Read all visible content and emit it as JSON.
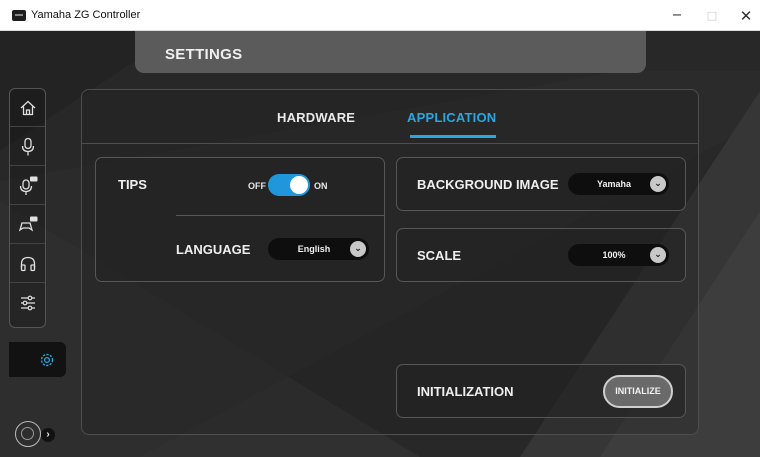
{
  "window": {
    "title": "Yamaha ZG Controller",
    "minimize_glyph": "−",
    "maximize_glyph": "□",
    "close_glyph": "✕"
  },
  "header": {
    "title": "SETTINGS"
  },
  "sidebar": {
    "items": [
      {
        "icon": "home-icon"
      },
      {
        "icon": "microphone-icon"
      },
      {
        "icon": "microphone-fx-icon"
      },
      {
        "icon": "gamepad-fx-icon"
      },
      {
        "icon": "headphones-icon"
      },
      {
        "icon": "sliders-icon"
      }
    ],
    "active_item": {
      "icon": "gear-icon"
    },
    "expand_glyph": "›"
  },
  "tabs": [
    {
      "label": "HARDWARE",
      "active": false
    },
    {
      "label": "APPLICATION",
      "active": true
    }
  ],
  "settings": {
    "tips": {
      "label": "TIPS",
      "off_label": "OFF",
      "on_label": "ON",
      "enabled": true
    },
    "language": {
      "label": "LANGUAGE",
      "value": "English"
    },
    "background_image": {
      "label": "BACKGROUND IMAGE",
      "value": "Yamaha"
    },
    "scale": {
      "label": "SCALE",
      "value": "100%"
    },
    "initialization": {
      "label": "INITIALIZATION",
      "button_label": "INITIALIZE"
    }
  },
  "colors": {
    "accent": "#2aa7e0",
    "toggle_on": "#1f97da",
    "background": "#272727",
    "header": "#5b5b5b"
  }
}
